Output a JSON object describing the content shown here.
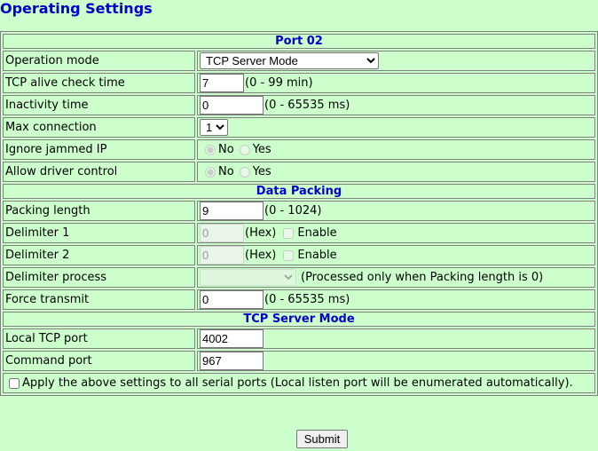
{
  "page": {
    "title": "Operating Settings"
  },
  "sections": {
    "port": "Port 02",
    "packing": "Data Packing",
    "mode": "TCP Server Mode"
  },
  "port": {
    "operation_mode": {
      "label": "Operation mode",
      "value": "TCP Server Mode"
    },
    "alive_check": {
      "label": "TCP alive check time",
      "value": "7",
      "hint": "(0 - 99 min)"
    },
    "inactivity": {
      "label": "Inactivity time",
      "value": "0",
      "hint": "(0 - 65535 ms)"
    },
    "max_connection": {
      "label": "Max connection",
      "value": "1"
    },
    "ignore_jammed": {
      "label": "Ignore jammed IP",
      "no": "No",
      "yes": "Yes"
    },
    "driver_control": {
      "label": "Allow driver control",
      "no": "No",
      "yes": "Yes"
    }
  },
  "packing": {
    "length": {
      "label": "Packing length",
      "value": "9",
      "hint": "(0 - 1024)"
    },
    "delimiter1": {
      "label": "Delimiter 1",
      "value": "0",
      "hex": "(Hex)",
      "enable": "Enable"
    },
    "delimiter2": {
      "label": "Delimiter 2",
      "value": "0",
      "hex": "(Hex)",
      "enable": "Enable"
    },
    "process": {
      "label": "Delimiter process",
      "value": "",
      "hint": "(Processed only when Packing length is 0)"
    },
    "force_transmit": {
      "label": "Force transmit",
      "value": "0",
      "hint": "(0 - 65535 ms)"
    }
  },
  "mode": {
    "local_port": {
      "label": "Local TCP port",
      "value": "4002"
    },
    "command_port": {
      "label": "Command port",
      "value": "967"
    }
  },
  "apply_all": {
    "label": "Apply the above settings to all serial ports (Local listen port will be enumerated automatically)."
  },
  "submit": {
    "label": "Submit"
  }
}
